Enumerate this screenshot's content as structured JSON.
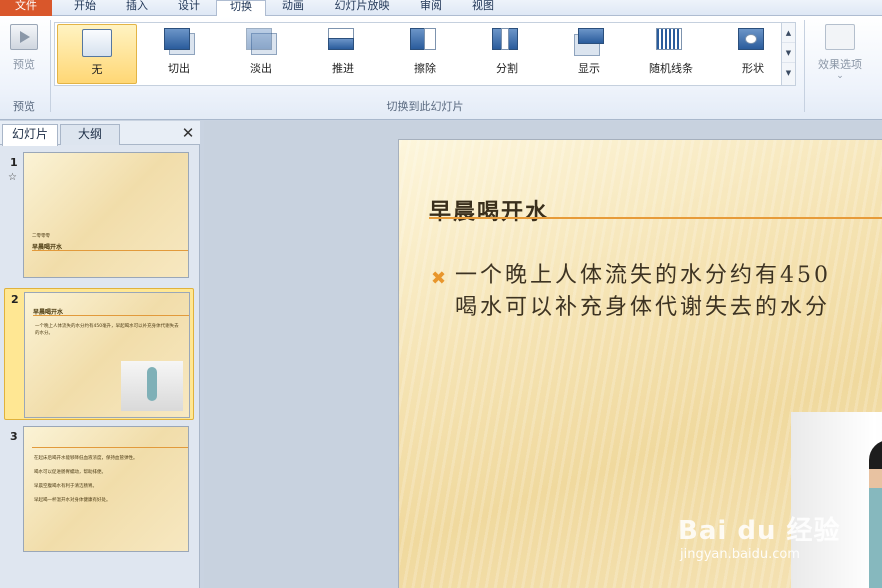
{
  "tabs": [
    "文件",
    "开始",
    "插入",
    "设计",
    "切换",
    "动画",
    "幻灯片放映",
    "审阅",
    "视图"
  ],
  "ribbon": {
    "preview_label": "预览",
    "preview_group_label": "预览",
    "transitions": [
      "无",
      "切出",
      "淡出",
      "推进",
      "擦除",
      "分割",
      "显示",
      "随机线条",
      "形状"
    ],
    "selected_transition": "无",
    "group_label": "切换到此幻灯片",
    "effect_options_label": "效果选项",
    "effect_arrow": "⌄"
  },
  "pane": {
    "tabs": [
      "幻灯片",
      "大纲"
    ],
    "close": "✕",
    "slides": [
      {
        "num": "1",
        "star": "☆",
        "title": "早晨喝开水",
        "subtitle": "二零零零"
      },
      {
        "num": "2",
        "title": "早晨喝开水",
        "text": "一个晚上人体流失的水分约有450毫升，早起喝水可以补充身体代谢失去的水分。"
      },
      {
        "num": "3",
        "lines": [
          "在起床后喝开水能够降低血液浓度，保持血管弹性。",
          "喝水可以促进肠胃蠕动，帮助排便。",
          "早晨空腹喝水有利于清洁肠胃。",
          "早起喝一杯温开水对身体健康有好处。"
        ]
      }
    ]
  },
  "slide": {
    "title": "早晨喝开水",
    "bullet": "✖",
    "line1": "一个晚上人体流失的水分约有450",
    "line2": "喝水可以补充身体代谢失去的水分"
  },
  "watermark": {
    "main": "Bai du 经验",
    "sub": "jingyan.baidu.com"
  },
  "colors": {
    "file_tab": "#d9572b",
    "selection": "#ffd775",
    "title_line": "#e79b39"
  }
}
